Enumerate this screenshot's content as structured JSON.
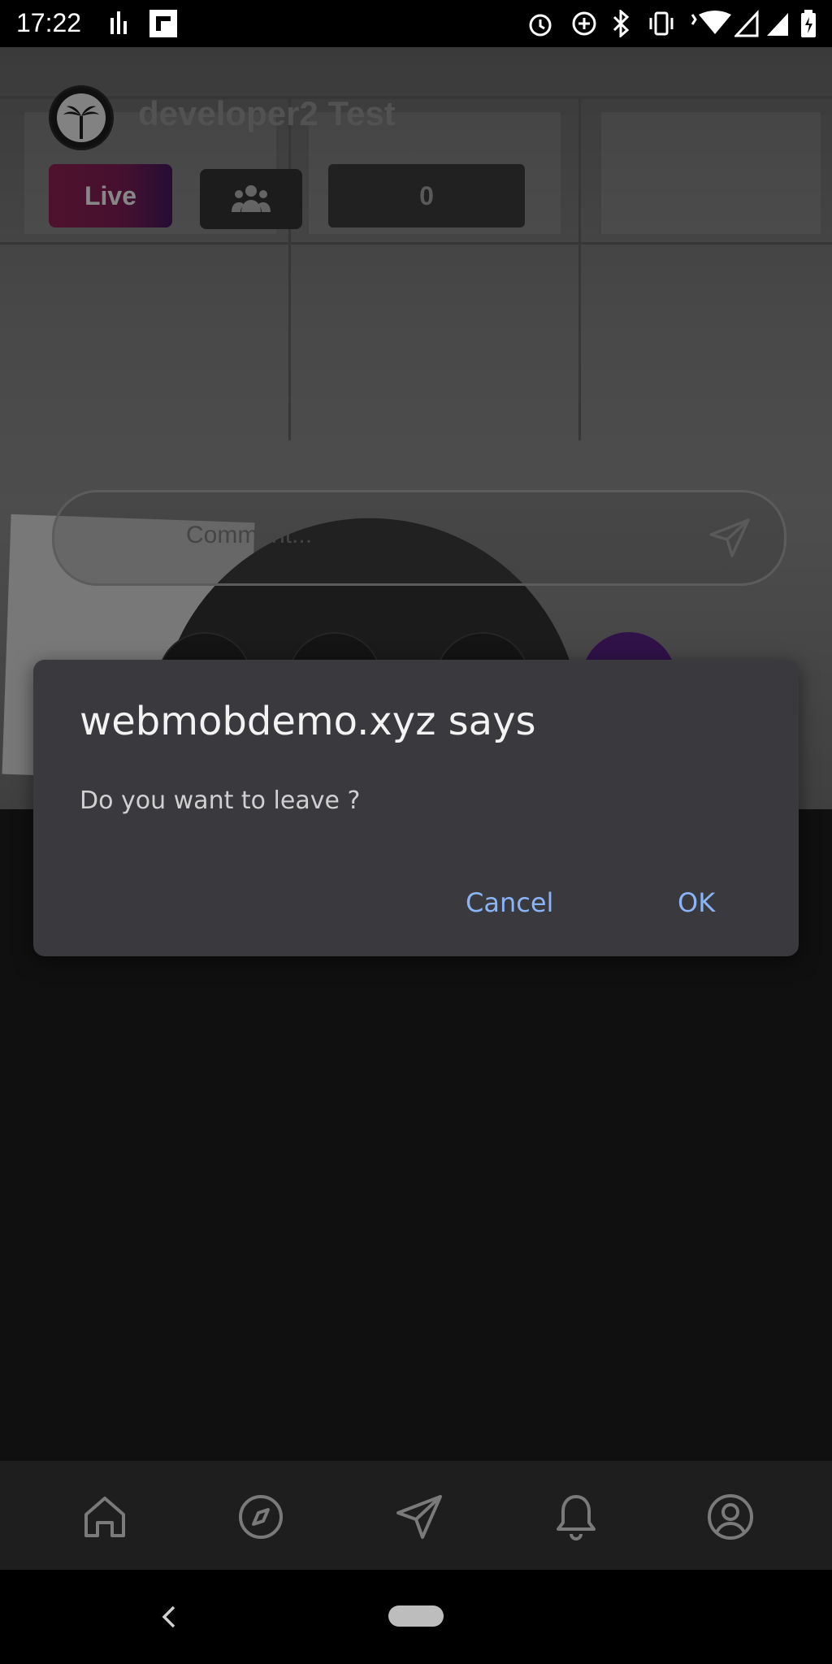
{
  "status_bar": {
    "time": "17:22",
    "left_icons": [
      "bars-icon",
      "flipboard-icon"
    ],
    "right_icons": [
      "alarm-icon",
      "data-saver-icon",
      "bluetooth-icon",
      "vibrate-icon",
      "wifi-icon",
      "signal-icon",
      "signal-icon",
      "battery-icon"
    ]
  },
  "header": {
    "avatar_icon": "palm-tree-avatar",
    "username": "developer2 Test",
    "live_label": "Live",
    "viewers_icon": "users-icon",
    "count": "0"
  },
  "comment": {
    "placeholder": "Comment...",
    "send_icon": "send-icon"
  },
  "dialog": {
    "title": "webmobdemo.xyz says",
    "message": "Do you want to leave ?",
    "cancel_label": "Cancel",
    "ok_label": "OK"
  },
  "bottom_nav": {
    "items": [
      {
        "icon": "home-icon"
      },
      {
        "icon": "compass-icon"
      },
      {
        "icon": "send-icon"
      },
      {
        "icon": "bell-icon"
      },
      {
        "icon": "profile-icon"
      }
    ]
  },
  "colors": {
    "dialog_bg": "#39393e",
    "dialog_button": "#8ab4f8",
    "live_gradient_start": "#7a1c44",
    "live_gradient_end": "#3a1450"
  }
}
